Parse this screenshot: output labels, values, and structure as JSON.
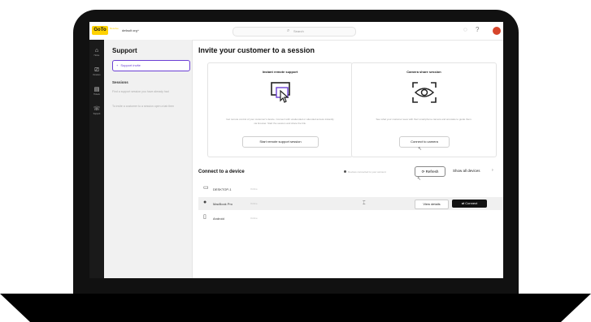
{
  "topbar": {
    "logo": "GoTo",
    "logo_sub": "Resolve",
    "account": "default org",
    "search_placeholder": "Search",
    "icons": [
      "help-icon",
      "settings-icon",
      "avatar"
    ]
  },
  "rail": {
    "items": [
      {
        "icon": "home-icon",
        "label": "Home"
      },
      {
        "icon": "devices-icon",
        "label": "Devices"
      },
      {
        "icon": "tickets-icon",
        "label": "Tickets"
      },
      {
        "icon": "support-icon",
        "label": "Support"
      }
    ]
  },
  "panel": {
    "title": "Support",
    "button_label": "Support invite",
    "section_title": "Sessions",
    "paragraphs": [
      "Find a support session you have already had",
      "To invite a customer to a session open a tab then"
    ]
  },
  "main": {
    "title": "Invite your customer to a session",
    "cards": [
      {
        "title": "Instant remote support",
        "icon": "remote-screen-icon",
        "description": "Get remote control of your customer's device. Connect with unattended or attended access instantly via browser. Start the session and share the link.",
        "button": "Start remote support session"
      },
      {
        "title": "Camera share session",
        "icon": "camera-eye-icon",
        "description": "See what your customer sees with their smartphone camera and annotate to guide them.",
        "button": "Connect to camera"
      }
    ],
    "devices": {
      "title": "Connect to a device",
      "hint": "Devices connected to your account",
      "refresh": "Refresh",
      "show_all": "Show all devices",
      "rows": [
        {
          "icon": "monitor-icon",
          "name": "DESKTOP-1",
          "status": "Online"
        },
        {
          "icon": "apple-icon",
          "name": "MacBook Pro",
          "status": "Online"
        },
        {
          "icon": "phone-icon",
          "name": "Android",
          "status": "Online"
        }
      ],
      "view_details": "View details",
      "connect": "Connect"
    }
  }
}
